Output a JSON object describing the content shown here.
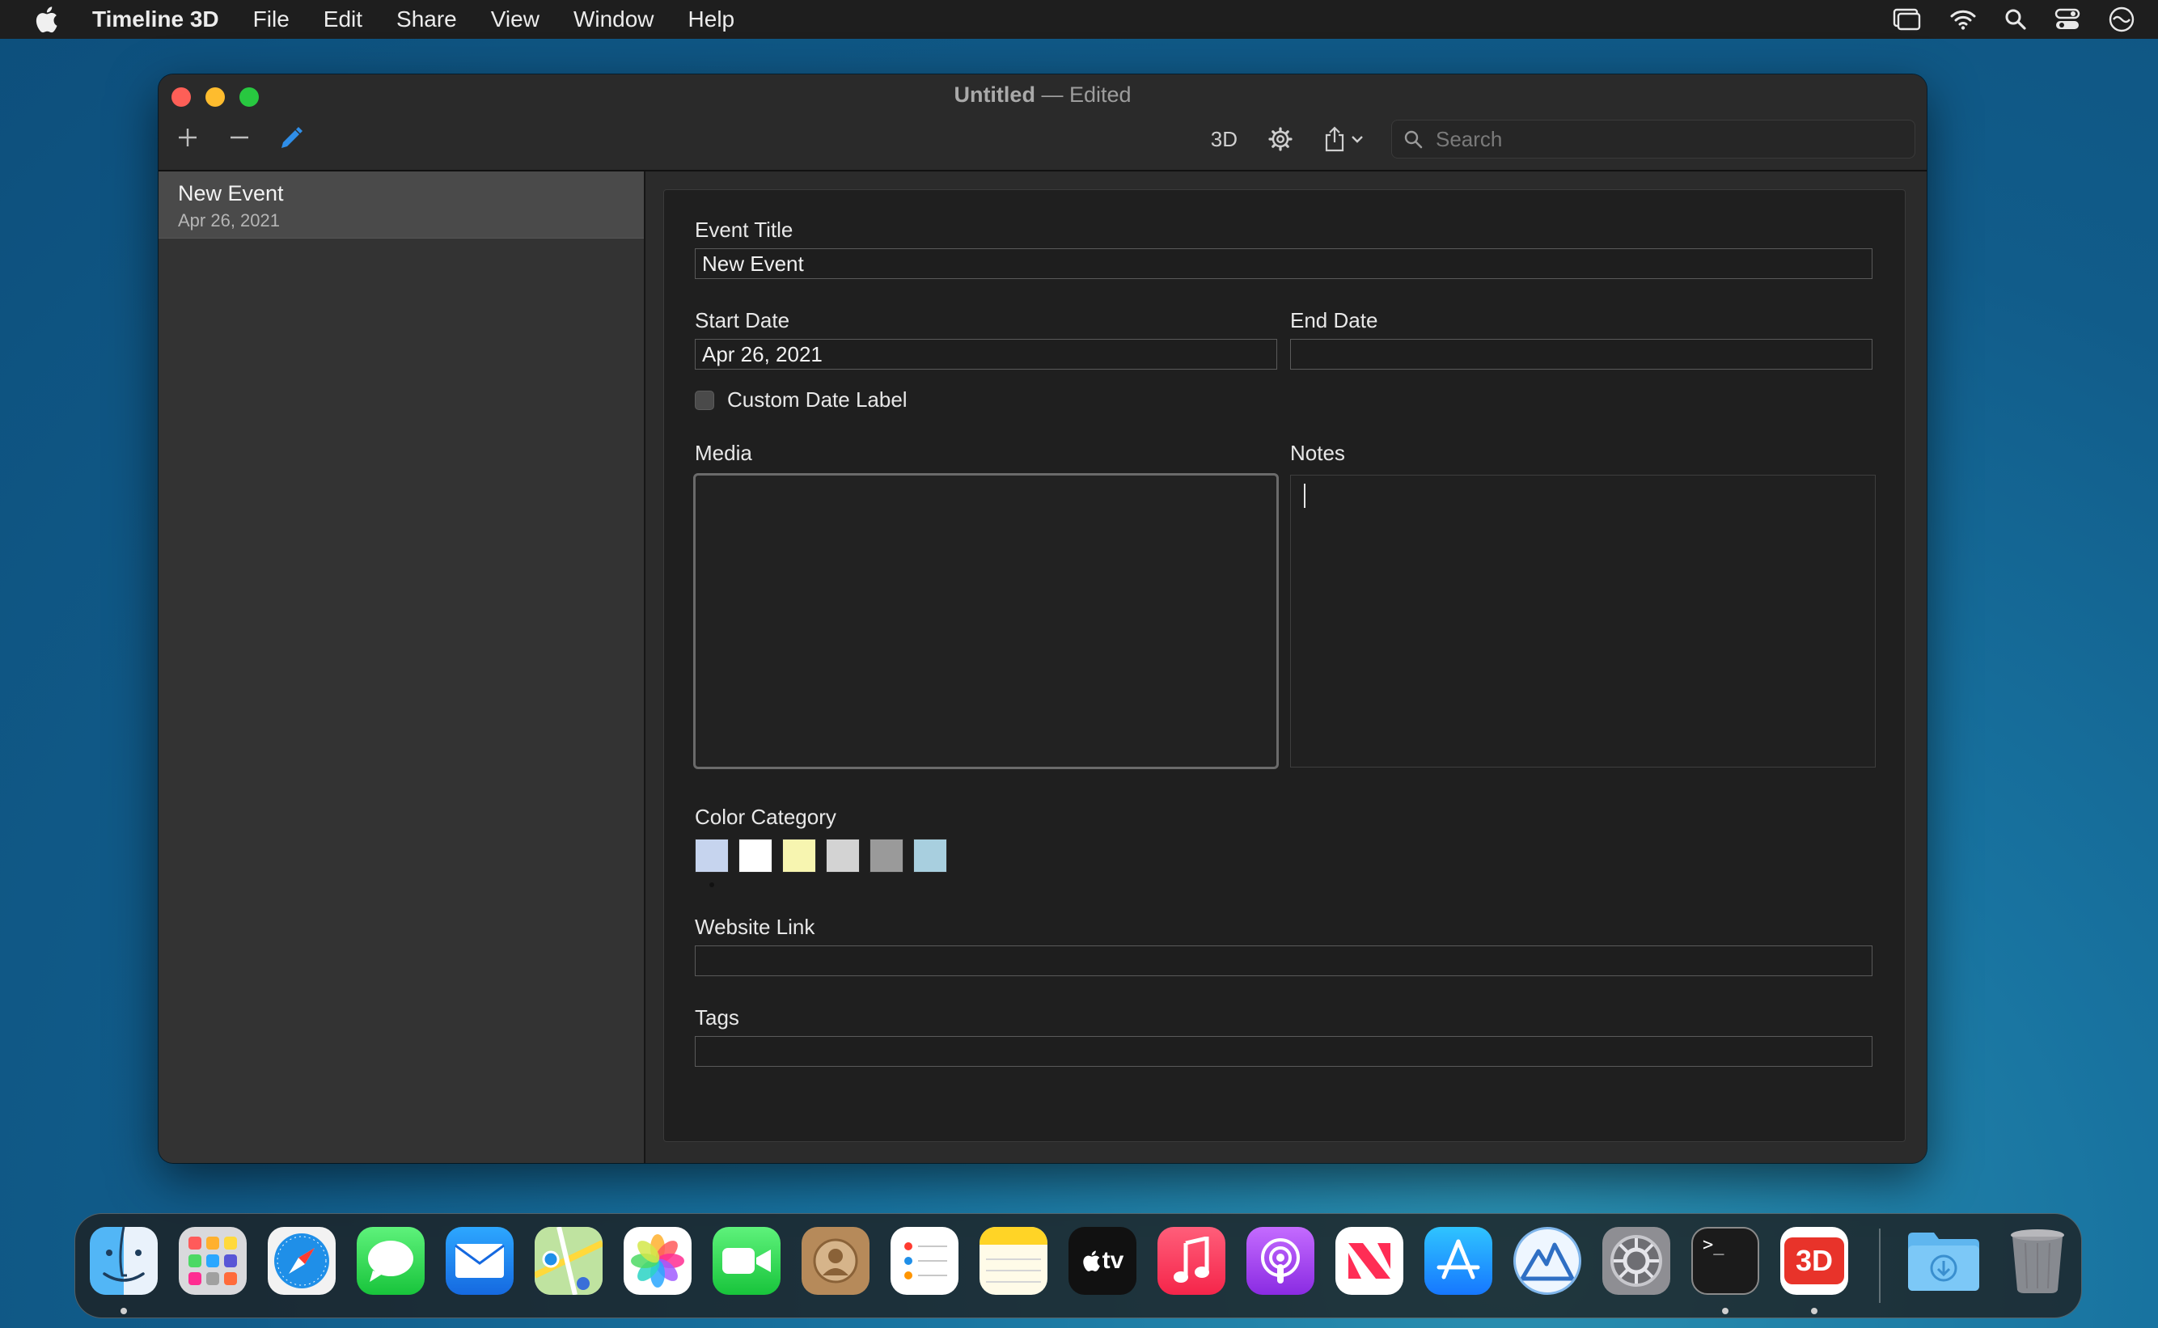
{
  "menubar": {
    "app_name": "Timeline 3D",
    "items": [
      "File",
      "Edit",
      "Share",
      "View",
      "Window",
      "Help"
    ]
  },
  "window": {
    "title": "Untitled",
    "title_separator": "—",
    "title_status": "Edited",
    "toolbar": {
      "view_3d_label": "3D",
      "search_placeholder": "Search"
    }
  },
  "sidebar": {
    "items": [
      {
        "title": "New Event",
        "date": "Apr 26, 2021",
        "selected": true
      }
    ]
  },
  "form": {
    "event_title_label": "Event Title",
    "event_title_value": "New Event",
    "start_date_label": "Start Date",
    "start_date_value": "Apr 26, 2021",
    "end_date_label": "End Date",
    "end_date_value": "",
    "custom_date_label": "Custom Date Label",
    "custom_date_checked": false,
    "media_label": "Media",
    "notes_label": "Notes",
    "notes_value": "",
    "color_category_label": "Color Category",
    "color_swatches": [
      "#c6d4ee",
      "#ffffff",
      "#f7f5b0",
      "#d3d3d3",
      "#9a9a9a",
      "#a8cfdf"
    ],
    "selected_swatch_index": 0,
    "website_link_label": "Website Link",
    "website_link_value": "",
    "tags_label": "Tags",
    "tags_value": ""
  },
  "dock": {
    "apps": [
      "finder-icon",
      "launchpad-icon",
      "safari-icon",
      "messages-icon",
      "mail-icon",
      "maps-icon",
      "photos-icon",
      "facetime-icon",
      "contacts-icon",
      "reminders-icon",
      "notes-icon",
      "appletv-icon",
      "music-icon",
      "podcasts-icon",
      "news-icon",
      "appstore-icon",
      "monterey-icon",
      "system-preferences-icon",
      "terminal-icon",
      "timeline3d-icon",
      "downloads-folder-icon",
      "trash-icon"
    ],
    "tv_label": "tv",
    "timeline3d_label": "3D",
    "terminal_label": ">_"
  },
  "colors": {
    "accent": "#2f8ee8",
    "close": "#fe5f57",
    "minimize": "#febc2e",
    "maximize": "#28c840"
  }
}
